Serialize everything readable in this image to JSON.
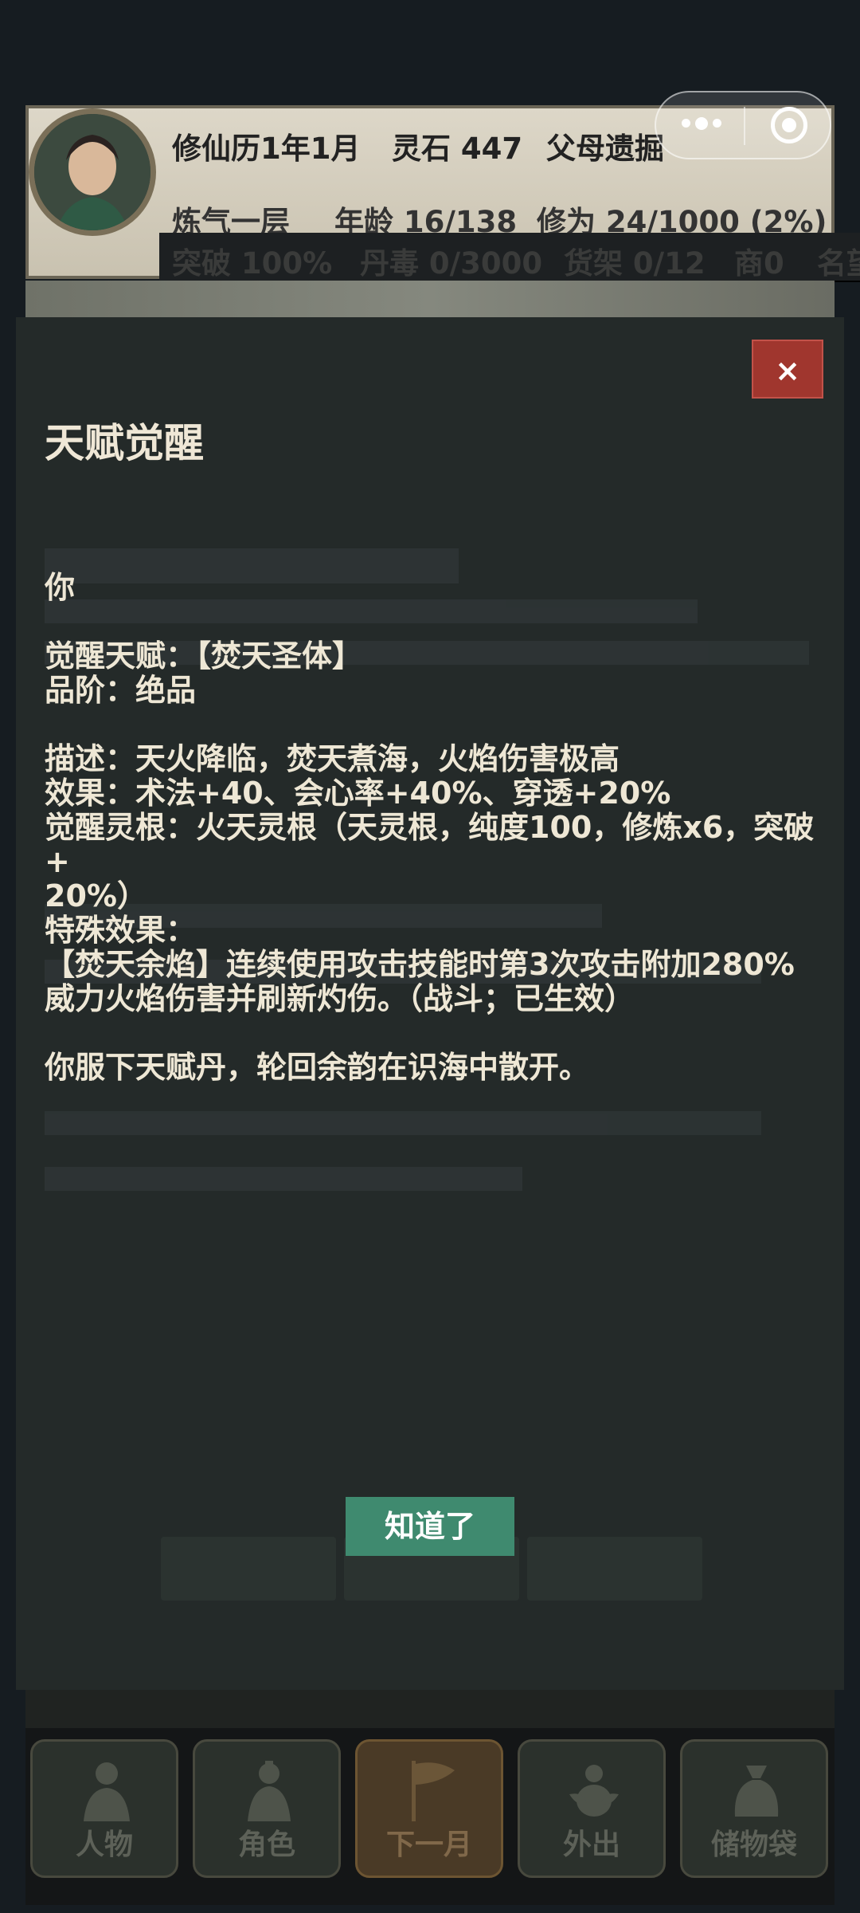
{
  "header": {
    "row1": {
      "date": "修仙历1年1月",
      "spirit_stones": "灵石 447",
      "background": "父母遗掘"
    },
    "row2": {
      "realm": "炼气一层",
      "age": "年龄 16/138",
      "cultivation": "修为 24/1000 (2%)"
    },
    "row3": {
      "breakthrough": "突破 100%",
      "pill_poison": "丹毒 0/3000",
      "shelf": "货架 0/12",
      "merchant": "商0",
      "fame": "名望"
    }
  },
  "modal": {
    "title": "天赋觉醒",
    "close_label": "×",
    "lines": [
      "你",
      "",
      "觉醒天赋：【焚天圣体】",
      "品阶：绝品",
      "",
      "描述：天火降临，焚天煮海，火焰伤害极高",
      "效果：术法+40、会心率+40%、穿透+20%",
      "觉醒灵根：火天灵根（天灵根，纯度100，修炼x6，突破+",
      "20%）",
      "特殊效果：",
      "【焚天余焰】连续使用攻击技能时第3次攻击附加280%",
      "威力火焰伤害并刷新灼伤。（战斗；已生效）",
      "",
      "你服下天赋丹，轮回余韵在识海中散开。"
    ],
    "confirm_label": "知道了"
  },
  "bottom_nav": {
    "items": [
      {
        "label": "人物",
        "icon": "person-icon"
      },
      {
        "label": "角色",
        "icon": "character-icon"
      },
      {
        "label": "下一月",
        "icon": "flag-icon"
      },
      {
        "label": "外出",
        "icon": "gourd-icon"
      },
      {
        "label": "储物袋",
        "icon": "bag-icon"
      }
    ]
  }
}
